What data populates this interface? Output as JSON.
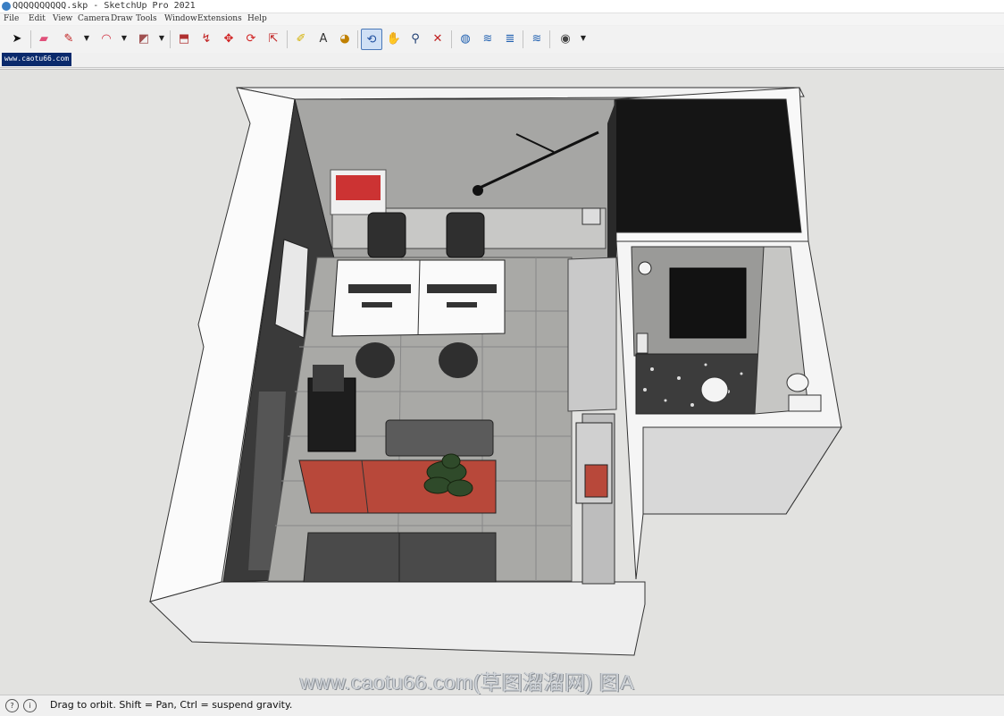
{
  "window": {
    "title": "QQQQQQQQQQ.skp - SketchUp Pro 2021"
  },
  "menu": [
    "File",
    "Edit",
    "View",
    "Camera",
    "Draw",
    "Tools",
    "Window",
    "Extensions",
    "Help"
  ],
  "toolbar": {
    "tools": [
      {
        "name": "select-tool-icon",
        "glyph": "➤",
        "color": "#111"
      },
      {
        "name": "eraser-tool-icon",
        "glyph": "▰",
        "color": "#e0507a"
      },
      {
        "name": "line-tool-icon",
        "glyph": "✎",
        "color": "#c02020"
      },
      {
        "name": "arc-tool-icon",
        "glyph": "◠",
        "color": "#d03040"
      },
      {
        "name": "shape-tool-icon",
        "glyph": "◩",
        "color": "#a05050"
      },
      {
        "name": "push-pull-tool-icon",
        "glyph": "⬒",
        "color": "#b03030"
      },
      {
        "name": "follow-me-tool-icon",
        "glyph": "↯",
        "color": "#c02020"
      },
      {
        "name": "move-tool-icon",
        "glyph": "✥",
        "color": "#d02020"
      },
      {
        "name": "rotate-tool-icon",
        "glyph": "⟳",
        "color": "#d02020"
      },
      {
        "name": "scale-tool-icon",
        "glyph": "⇱",
        "color": "#c02020"
      },
      {
        "name": "tape-measure-tool-icon",
        "glyph": "✐",
        "color": "#d4b000"
      },
      {
        "name": "text-tool-icon",
        "glyph": "A",
        "color": "#333"
      },
      {
        "name": "paint-bucket-tool-icon",
        "glyph": "◕",
        "color": "#c08000"
      },
      {
        "name": "orbit-tool-icon",
        "glyph": "⟲",
        "color": "#2050a0"
      },
      {
        "name": "pan-tool-icon",
        "glyph": "✋",
        "color": "#d8b070"
      },
      {
        "name": "zoom-tool-icon",
        "glyph": "⚲",
        "color": "#1a3a70"
      },
      {
        "name": "zoom-extents-tool-icon",
        "glyph": "✕",
        "color": "#c02020"
      },
      {
        "name": "warehouse-icon",
        "glyph": "◍",
        "color": "#2060b0"
      },
      {
        "name": "extension-warehouse-icon",
        "glyph": "≋",
        "color": "#2060b0"
      },
      {
        "name": "layout-icon",
        "glyph": "≣",
        "color": "#2060b0"
      },
      {
        "name": "extension-manager-icon",
        "glyph": "≋",
        "color": "#2060b0"
      },
      {
        "name": "account-icon",
        "glyph": "◉",
        "color": "#444"
      }
    ]
  },
  "tab": {
    "label": "www.caotu66.com"
  },
  "watermark": "www.caotu66.com(草图溜溜网) 图A",
  "status": {
    "message": "Drag to orbit. Shift = Pan, Ctrl = suspend gravity."
  },
  "colors": {
    "viewport_bg": "#e2e2e0",
    "wall": "#fafafa",
    "floor": "#a9a9a6",
    "sofa": "#b8483a",
    "tab_bg": "#0a2a6c"
  }
}
